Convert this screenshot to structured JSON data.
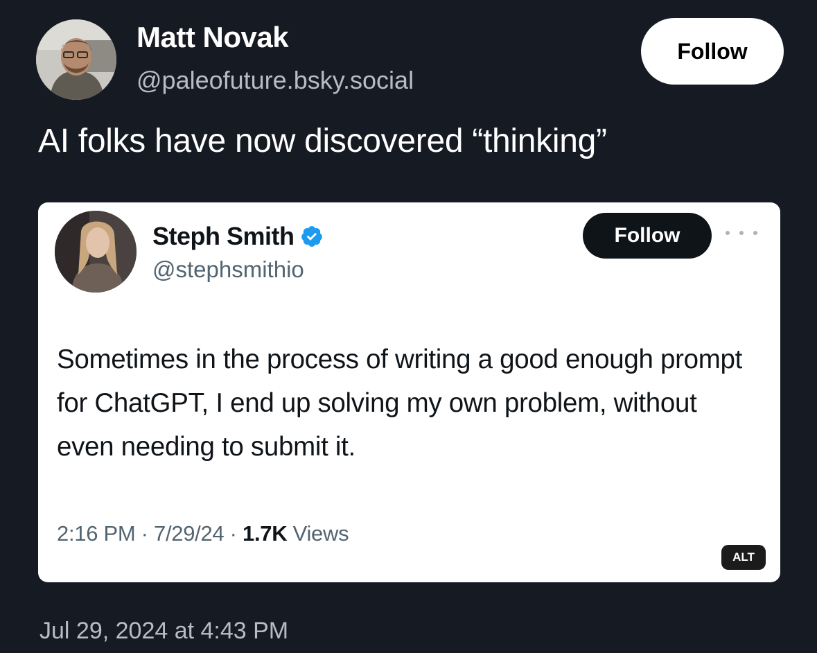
{
  "post": {
    "author_name": "Matt Novak",
    "author_handle": "@paleofuture.bsky.social",
    "follow_label": "Follow",
    "text": "AI folks have now discovered “thinking”",
    "date": "Jul 29, 2024 at 4:43 PM"
  },
  "embed": {
    "author_name": "Steph Smith",
    "author_handle": "@stephsmithio",
    "follow_label": "Follow",
    "text": "Sometimes in the process of writing a good enough prompt for ChatGPT, I end up solving my own problem, without even needing to submit it.",
    "time": "2:16 PM",
    "date": "7/29/24",
    "views_count": "1.7K",
    "views_label": "Views",
    "separator": " · ",
    "alt_label": "ALT"
  },
  "icons": {
    "verified": "verified-badge-icon",
    "more": "more-options-icon"
  },
  "colors": {
    "background": "#161a23",
    "card": "#ffffff",
    "verified": "#1d9bf0"
  }
}
